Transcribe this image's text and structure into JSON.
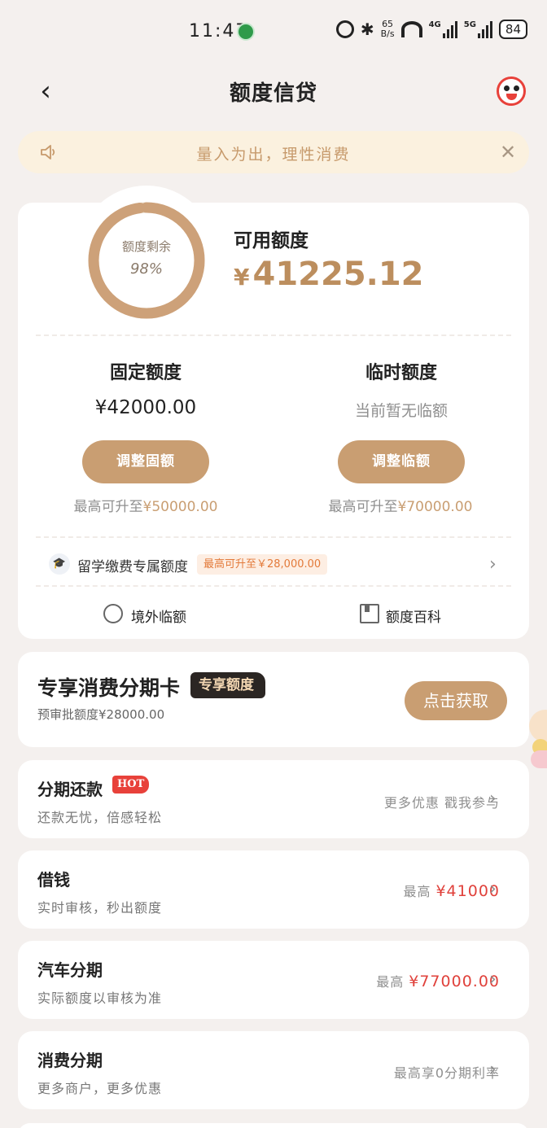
{
  "status_bar": {
    "time": "11:47",
    "net_speed_value": "65",
    "net_speed_unit": "B/s",
    "sig1_label": "4G",
    "sig2_label": "5G",
    "battery": "84"
  },
  "header": {
    "title": "额度信贷",
    "back_glyph": "‹"
  },
  "notice": {
    "text": "量入为出，理性消费",
    "close_glyph": "✕"
  },
  "quota": {
    "remaining_label": "额度剩余",
    "remaining_pct": "98%",
    "remaining_fraction": 0.98,
    "available_label": "可用额度",
    "available_yen": "¥",
    "available_amount": "41225.12",
    "fixed": {
      "title": "固定额度",
      "value": "¥42000.00",
      "button": "调整固额",
      "hint_prefix": "最高可升至",
      "hint_amount": "¥50000.00"
    },
    "temp": {
      "title": "临时额度",
      "value": "当前暂无临额",
      "button": "调整临额",
      "hint_prefix": "最高可升至",
      "hint_amount": "¥70000.00"
    },
    "edu": {
      "label": "留学缴费专属额度",
      "tag": "最高可升至￥28,000.00"
    },
    "links": {
      "overseas": "境外临额",
      "wiki": "额度百科"
    }
  },
  "promo": {
    "title": "专享消费分期卡",
    "tag": "专享额度",
    "sub": "预审批额度¥28000.00",
    "button": "点击获取"
  },
  "rows": [
    {
      "title": "分期还款",
      "badge": "HOT",
      "sub": "还款无忧，倍感轻松",
      "right_text": "更多优惠 戳我参与",
      "amount": ""
    },
    {
      "title": "借钱",
      "sub": "实时审核，秒出额度",
      "right_text": "最高",
      "amount": "¥41000"
    },
    {
      "title": "汽车分期",
      "sub": "实际额度以审核为准",
      "right_text": "最高",
      "amount": "¥77000.00"
    },
    {
      "title": "消费分期",
      "sub": "更多商户，更多优惠",
      "right_text": "最高享0分期利率",
      "amount": ""
    }
  ],
  "colors": {
    "accent": "#c99e72",
    "accent_text": "#bc8e5e",
    "red": "#e0413b",
    "background": "#f4f0ee"
  }
}
